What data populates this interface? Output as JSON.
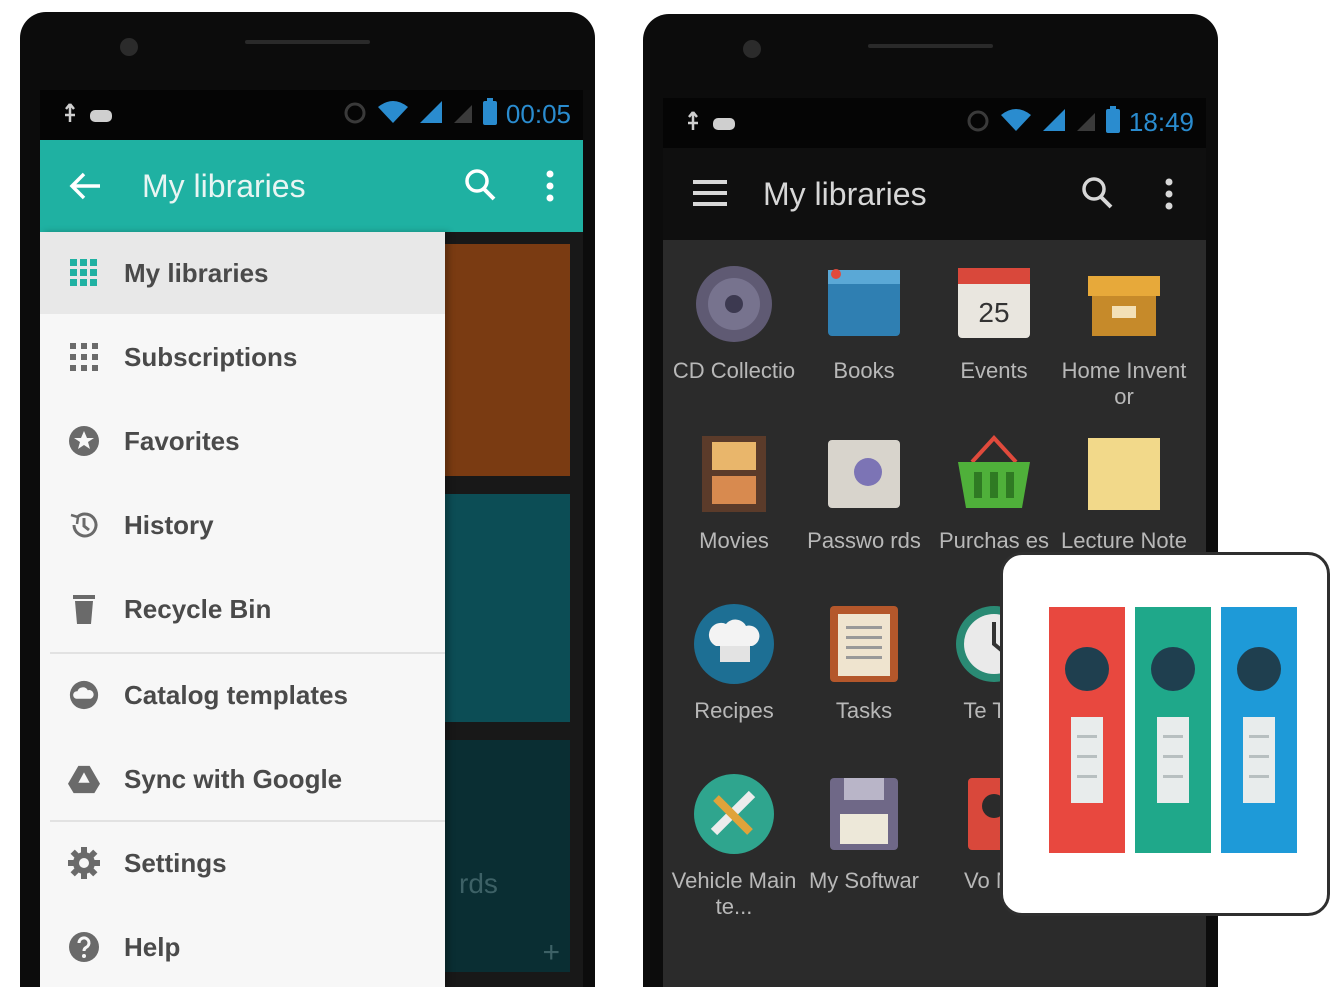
{
  "phone_left": {
    "status": {
      "time": "00:05"
    },
    "appbar": {
      "title": "My libraries"
    },
    "drawer": {
      "items": [
        {
          "label": "My libraries",
          "icon": "grid-icon",
          "active": true
        },
        {
          "label": "Subscriptions",
          "icon": "grid-icon"
        },
        {
          "label": "Favorites",
          "icon": "star-icon"
        },
        {
          "label": "History",
          "icon": "history-icon"
        },
        {
          "label": "Recycle Bin",
          "icon": "trash-icon"
        },
        {
          "label": "Catalog templates",
          "icon": "cloud-icon"
        },
        {
          "label": "Sync with Google",
          "icon": "google-drive-icon"
        },
        {
          "label": "Settings",
          "icon": "gear-icon"
        },
        {
          "label": "Help",
          "icon": "help-icon"
        }
      ]
    },
    "background_card_text": "rds",
    "colors": {
      "appbar": "#1fb1a2",
      "card1": "#7a3b12",
      "card2": "#0c4d55",
      "card3": "#0a2e33"
    }
  },
  "phone_right": {
    "status": {
      "time": "18:49"
    },
    "appbar": {
      "title": "My libraries"
    },
    "libraries": [
      {
        "label": "CD Collectio",
        "icon": "cd-icon"
      },
      {
        "label": "Books",
        "icon": "books-icon"
      },
      {
        "label": "Events",
        "icon": "calendar-icon",
        "day": "25"
      },
      {
        "label": "Home Inventor",
        "icon": "box-icon"
      },
      {
        "label": "Movies",
        "icon": "film-icon"
      },
      {
        "label": "Passwo rds",
        "icon": "safe-icon"
      },
      {
        "label": "Purchas es",
        "icon": "basket-icon"
      },
      {
        "label": "Lecture Notes",
        "icon": "notes-icon"
      },
      {
        "label": "Recipes",
        "icon": "chef-hat-icon"
      },
      {
        "label": "Tasks",
        "icon": "clipboard-icon"
      },
      {
        "label": "Te Tra",
        "icon": "clock-icon"
      },
      {
        "label": "Vehicle Mainte...",
        "icon": "wrench-icon"
      },
      {
        "label": "My Softwar",
        "icon": "floppy-icon"
      },
      {
        "label": "Vo No",
        "icon": "voice-icon"
      }
    ]
  },
  "overlay": {
    "binders": [
      {
        "color": "#e8483f"
      },
      {
        "color": "#1fa88a"
      },
      {
        "color": "#1e9ad8"
      }
    ]
  }
}
